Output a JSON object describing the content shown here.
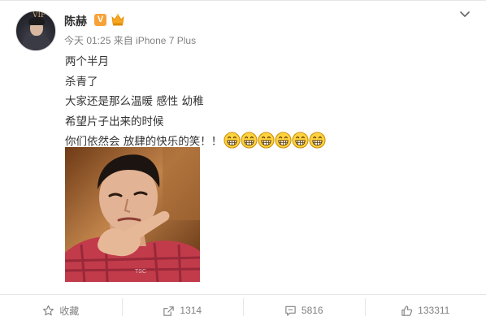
{
  "post": {
    "author": {
      "name": "陈赫",
      "avatar_badge": "VIP",
      "verified_badge": "V"
    },
    "meta": {
      "time": "今天 01:25",
      "source": "来自 iPhone 7 Plus"
    },
    "lines": [
      "两个半月",
      "杀青了",
      "大家还是那么温暖 感性 幼稚",
      "希望片子出来的时候",
      "你们依然会 放肆的快乐的笑！！"
    ],
    "emoji_count": 6,
    "emoji_icon": "grinning-face-icon"
  },
  "actions": {
    "favorite_label": "收藏",
    "repost_count": "1314",
    "comment_count": "5816",
    "like_count": "133311"
  },
  "colors": {
    "text": "#333333",
    "muted": "#808080",
    "divider": "#e6e6e6",
    "verified_orange": "#f7a238",
    "emoji_yellow": "#ffd23f"
  }
}
